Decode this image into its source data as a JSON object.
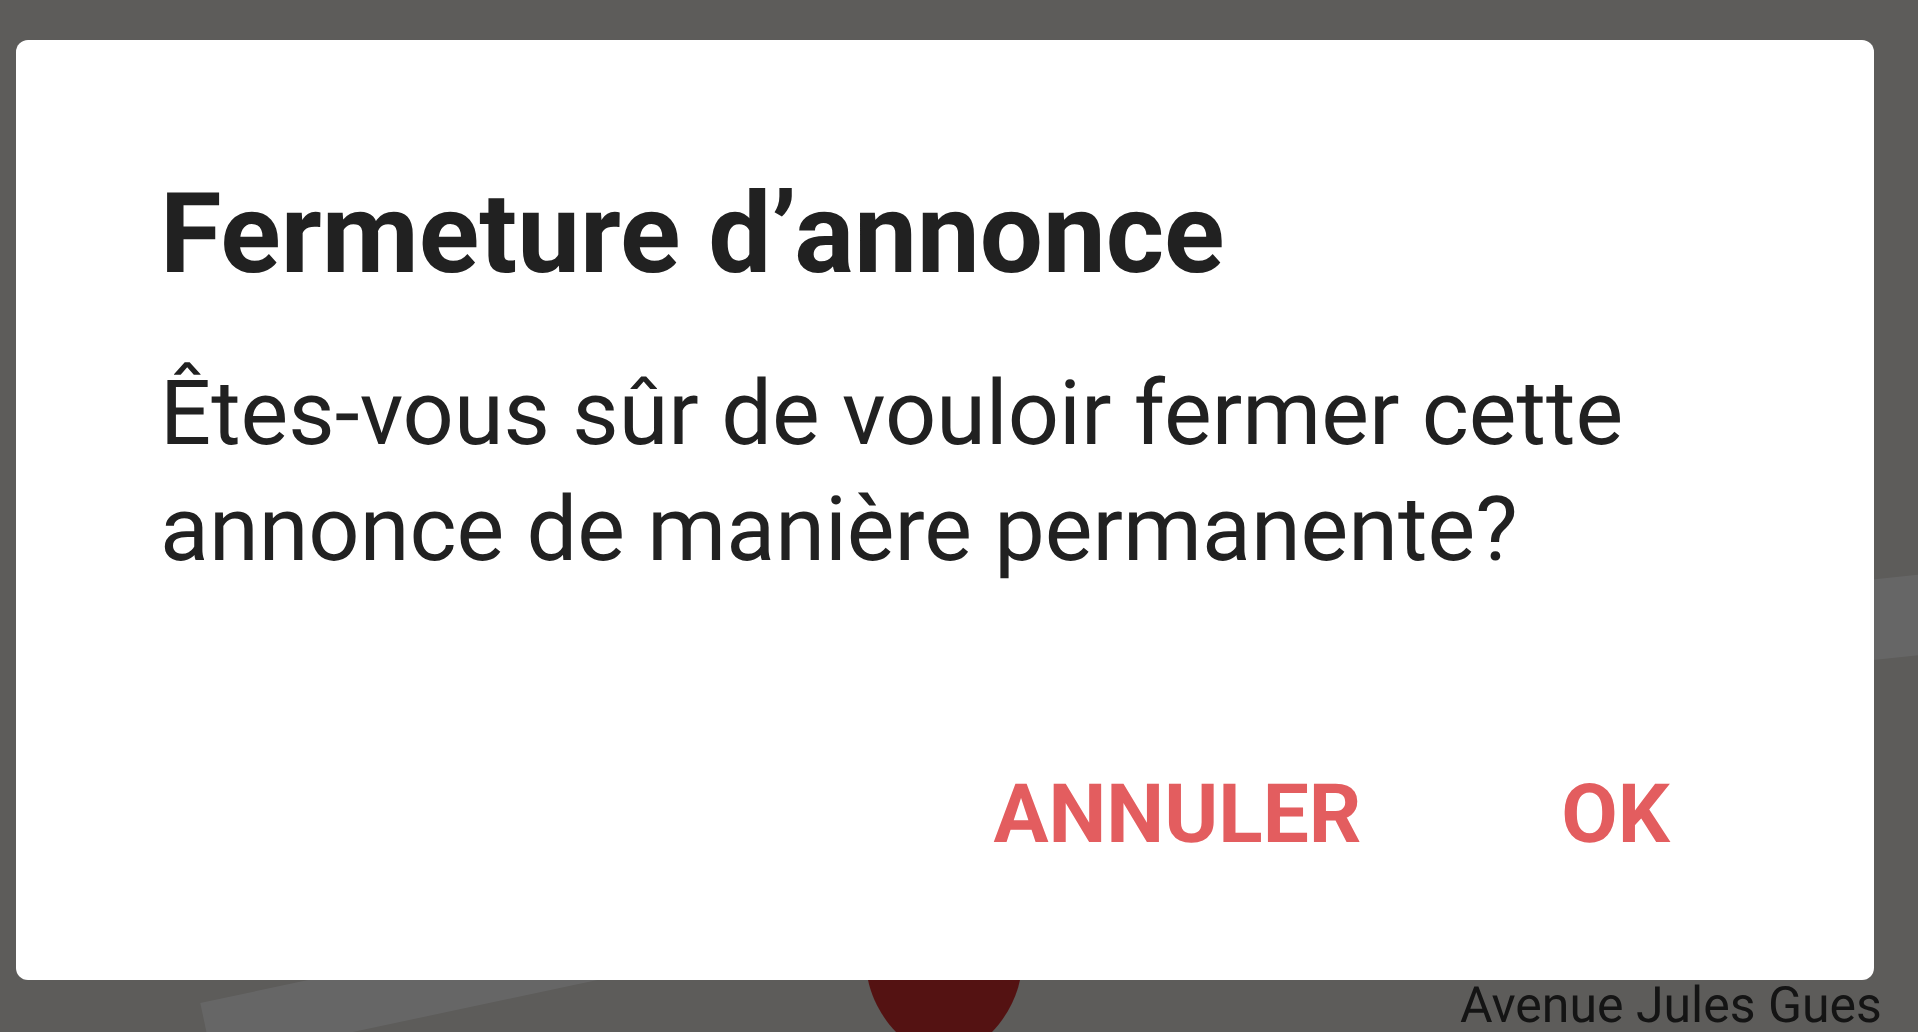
{
  "map": {
    "street_label": "Avenue Jules Gues"
  },
  "dialog": {
    "title": "Fermeture d’annonce",
    "message": "Êtes-vous sûr de vouloir fermer cette annonce de manière permanente?",
    "buttons": [
      {
        "label": "ANNULER"
      },
      {
        "label": "OK"
      }
    ]
  }
}
